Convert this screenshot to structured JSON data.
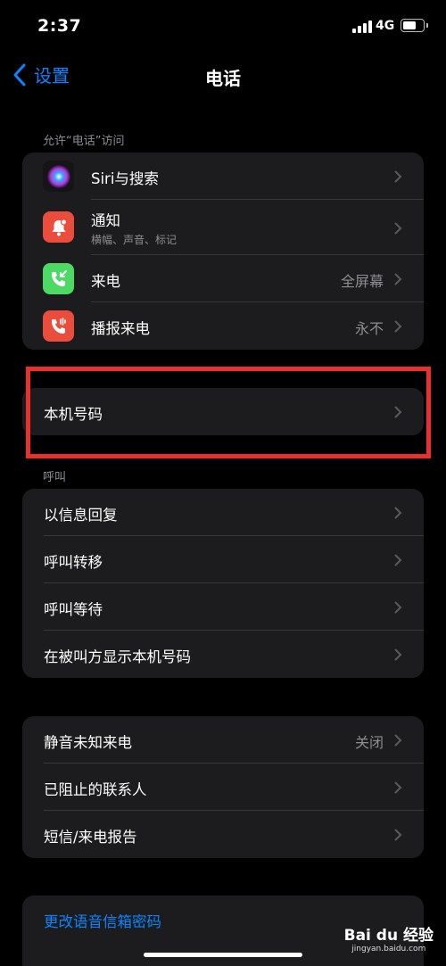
{
  "status": {
    "time": "2:37",
    "network": "4G"
  },
  "nav": {
    "back_label": "设置",
    "title": "电话"
  },
  "sections": {
    "allow_access": "允许“电话”访问",
    "calls": "呼叫"
  },
  "access_items": [
    {
      "label": "Siri与搜索",
      "icon": "siri-icon"
    },
    {
      "label": "通知",
      "sublabel": "横幅、声音、标记",
      "icon": "bell-icon",
      "icon_color": "#eb4d3d"
    },
    {
      "label": "来电",
      "value": "全屏幕",
      "icon": "incoming-call-icon",
      "icon_color": "#4cd964"
    },
    {
      "label": "播报来电",
      "value": "永不",
      "icon": "announce-call-icon",
      "icon_color": "#eb4d3d"
    }
  ],
  "my_number": {
    "label": "本机号码"
  },
  "call_items": [
    {
      "label": "以信息回复"
    },
    {
      "label": "呼叫转移"
    },
    {
      "label": "呼叫等待"
    },
    {
      "label": "在被叫方显示本机号码"
    }
  ],
  "block_items": [
    {
      "label": "静音未知来电",
      "value": "关闭"
    },
    {
      "label": "已阻止的联系人"
    },
    {
      "label": "短信/来电报告"
    }
  ],
  "voicemail": {
    "label": "更改语音信箱密码"
  },
  "watermark": {
    "brand": "Bai du 经验",
    "url": "jingyan.baidu.com"
  },
  "colors": {
    "accent": "#0a84ff",
    "highlight_box": "#e8312c",
    "background": "#000000",
    "cell": "#1c1c1e"
  }
}
